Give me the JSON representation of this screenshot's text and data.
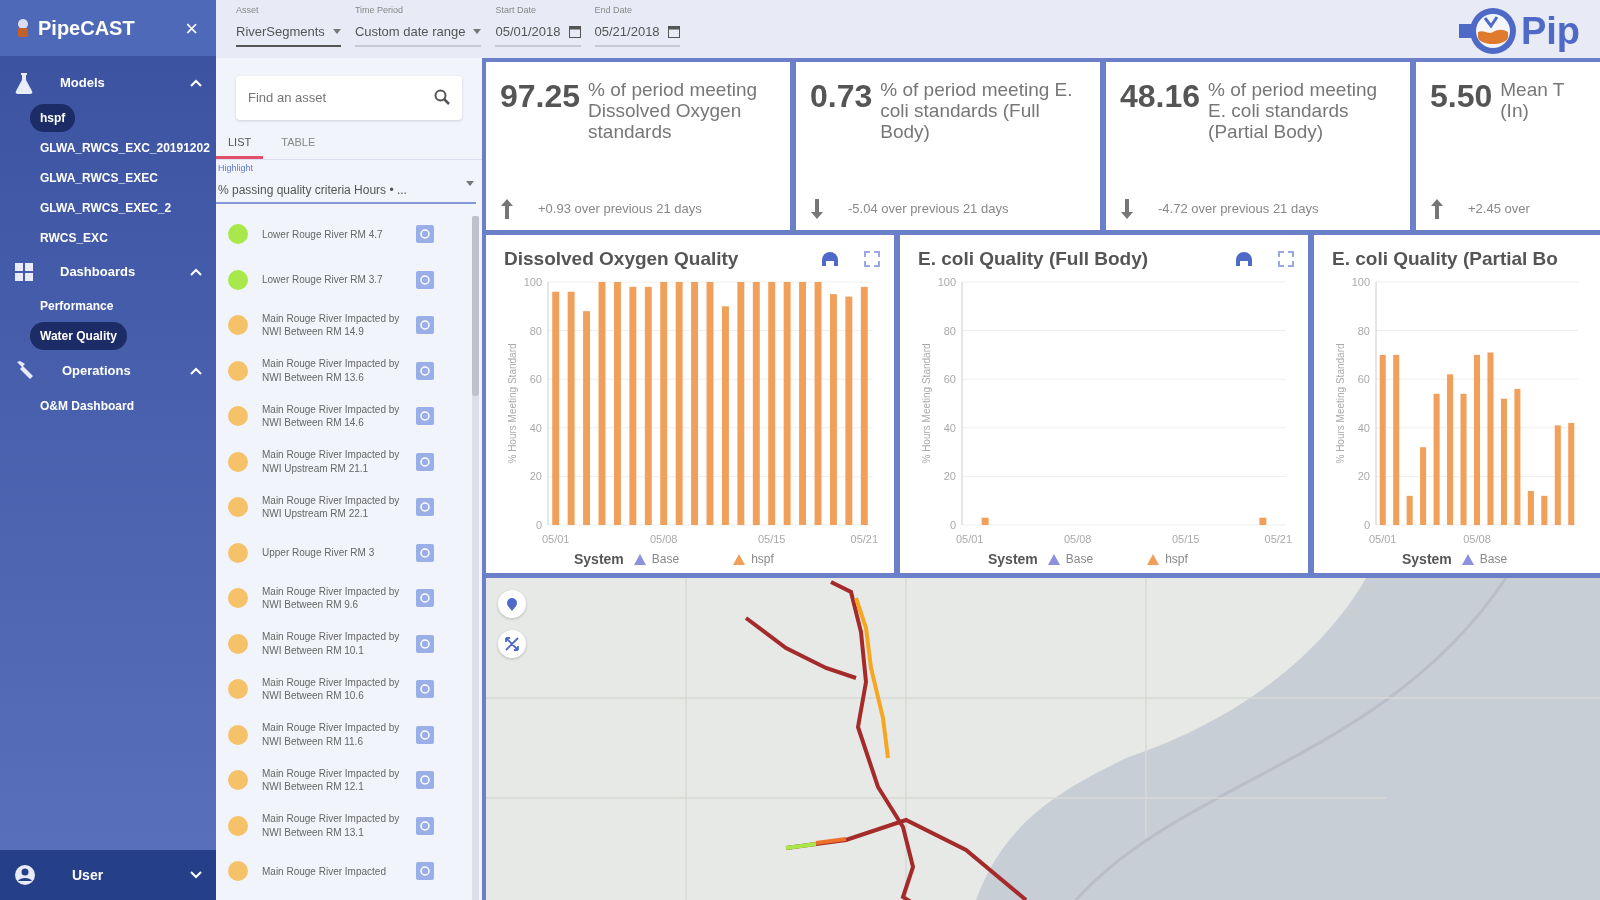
{
  "sidebar": {
    "title": "PipeCAST",
    "close": "×",
    "groups": [
      {
        "label": "Models",
        "expanded": true,
        "items": [
          {
            "label": "hspf",
            "selected": true
          },
          {
            "label": "GLWA_RWCS_EXC_20191202",
            "selected": false
          },
          {
            "label": "GLWA_RWCS_EXEC",
            "selected": false
          },
          {
            "label": "GLWA_RWCS_EXEC_2",
            "selected": false
          },
          {
            "label": "RWCS_EXC",
            "selected": false
          }
        ]
      },
      {
        "label": "Dashboards",
        "expanded": true,
        "items": [
          {
            "label": "Performance",
            "selected": false
          },
          {
            "label": "Water Quality",
            "selected": true
          }
        ]
      },
      {
        "label": "Operations",
        "expanded": true,
        "items": [
          {
            "label": "O&M Dashboard",
            "selected": false
          }
        ]
      }
    ],
    "user": {
      "label": "User",
      "expanded": false
    }
  },
  "toolbar": {
    "fields": [
      {
        "label": "Asset",
        "value": "RiverSegments",
        "kind": "select"
      },
      {
        "label": "Time Period",
        "value": "Custom date range",
        "kind": "select"
      },
      {
        "label": "Start Date",
        "value": "05/01/2018",
        "kind": "date"
      },
      {
        "label": "End Date",
        "value": "05/21/2018",
        "kind": "date"
      }
    ],
    "logo_text": "Pip"
  },
  "asset_panel": {
    "search": {
      "placeholder": "Find an asset"
    },
    "tabs": [
      {
        "label": "LIST",
        "selected": true
      },
      {
        "label": "TABLE",
        "selected": false
      }
    ],
    "highlight": {
      "label": "Highlight",
      "value": "% passing quality criteria Hours • ..."
    },
    "assets": [
      {
        "name": "Lower Rouge River RM 4.7",
        "color": "#a8e84a"
      },
      {
        "name": "Lower Rouge River RM 3.7",
        "color": "#a8e84a"
      },
      {
        "name": "Main Rouge River Impacted by NWI Between RM 14.9",
        "color": "#f5c26a"
      },
      {
        "name": "Main Rouge River Impacted by NWI Between RM 13.6",
        "color": "#f5c26a"
      },
      {
        "name": "Main Rouge River Impacted by NWI Between RM 14.6",
        "color": "#f5c26a"
      },
      {
        "name": "Main Rouge River Impacted by NWI Upstream RM 21.1",
        "color": "#f5c26a"
      },
      {
        "name": "Main Rouge River Impacted by NWI Upstream RM 22.1",
        "color": "#f5c26a"
      },
      {
        "name": "Upper Rouge River RM 3",
        "color": "#f5c26a"
      },
      {
        "name": "Main Rouge River Impacted by NWI Between RM 9.6",
        "color": "#f5c26a"
      },
      {
        "name": "Main Rouge River Impacted by NWI Between RM 10.1",
        "color": "#f5c26a"
      },
      {
        "name": "Main Rouge River Impacted by NWI Between RM 10.6",
        "color": "#f5c26a"
      },
      {
        "name": "Main Rouge River Impacted by NWI Between RM 11.6",
        "color": "#f5c26a"
      },
      {
        "name": "Main Rouge River Impacted by NWI Between RM 12.1",
        "color": "#f5c26a"
      },
      {
        "name": "Main Rouge River Impacted by NWI Between RM 13.1",
        "color": "#f5c26a"
      },
      {
        "name": "Main Rouge River Impacted",
        "color": "#f5c26a"
      }
    ]
  },
  "kpis": [
    {
      "value": "97.25",
      "label": "% of period meeting Dissolved Oxygen standards",
      "kind": "up",
      "delta": "+0.93 over previous 21 days"
    },
    {
      "value": "0.73",
      "label": "% of period meeting E. coli standards (Full Body)",
      "kind": "down",
      "delta": "-5.04 over previous 21 days"
    },
    {
      "value": "48.16",
      "label": "% of period meeting E. coli standards (Partial Body)",
      "kind": "down",
      "delta": "-4.72 over previous 21 days"
    },
    {
      "value": "5.50",
      "label": "Mean T (In)",
      "kind": "up",
      "delta": "+2.45 over"
    }
  ],
  "charts": [
    {
      "title": "Dissolved Oxygen Quality",
      "legend_title": "System",
      "chart_data": {
        "type": "bar",
        "ylabel": "% Hours Meeting Standard",
        "grid": true,
        "categories": [
          "05/01",
          null,
          null,
          null,
          null,
          null,
          null,
          "05/08",
          null,
          null,
          null,
          null,
          null,
          null,
          "05/15",
          null,
          null,
          null,
          null,
          null,
          "05/21"
        ],
        "series": [
          {
            "name": "Base",
            "color": "#8d90dc",
            "values": [
              null,
              null,
              null,
              null,
              null,
              null,
              null,
              null,
              null,
              null,
              null,
              null,
              null,
              null,
              null,
              null,
              null,
              null,
              null,
              null,
              null
            ]
          },
          {
            "name": "hspf",
            "color": "#f0a05a",
            "values": [
              96,
              96,
              88,
              100,
              100,
              98,
              98,
              100,
              100,
              100,
              100,
              90,
              100,
              100,
              100,
              100,
              100,
              100,
              95,
              94,
              98
            ]
          }
        ],
        "ylim": [
          0,
          100
        ],
        "yticks": [
          0,
          20,
          40,
          60,
          80,
          100
        ]
      }
    },
    {
      "title": "E. coli Quality (Full Body)",
      "legend_title": "System",
      "chart_data": {
        "type": "bar",
        "ylabel": "% Hours Meeting Standard",
        "grid": true,
        "categories": [
          "05/01",
          null,
          null,
          null,
          null,
          null,
          null,
          "05/08",
          null,
          null,
          null,
          null,
          null,
          null,
          "05/15",
          null,
          null,
          null,
          null,
          null,
          "05/21"
        ],
        "series": [
          {
            "name": "Base",
            "color": "#8d90dc",
            "values": [
              null,
              null,
              null,
              null,
              null,
              null,
              null,
              null,
              null,
              null,
              null,
              null,
              null,
              null,
              null,
              null,
              null,
              null,
              null,
              null,
              null
            ]
          },
          {
            "name": "hspf",
            "color": "#f0a05a",
            "values": [
              0,
              3,
              0,
              0,
              0,
              0,
              0,
              0,
              0,
              0,
              0,
              0,
              0,
              0,
              0,
              0,
              0,
              0,
              0,
              3,
              0
            ]
          }
        ],
        "ylim": [
          0,
          100
        ],
        "yticks": [
          0,
          20,
          40,
          60,
          80,
          100
        ]
      }
    },
    {
      "title": "E. coli Quality (Partial Bo",
      "legend_title": "System",
      "chart_data": {
        "type": "bar",
        "ylabel": "% Hours Meeting Standard",
        "grid": true,
        "categories": [
          "05/01",
          null,
          null,
          null,
          null,
          null,
          null,
          "05/08",
          null,
          null,
          null,
          null,
          null,
          null,
          null
        ],
        "series": [
          {
            "name": "Base",
            "color": "#8d90dc",
            "values": [
              null,
              null,
              null,
              null,
              null,
              null,
              null,
              null,
              null,
              null,
              null,
              null,
              null,
              null,
              null
            ]
          },
          {
            "color": "#f0a05a",
            "values": [
              70,
              70,
              12,
              32,
              54,
              62,
              54,
              70,
              71,
              52,
              56,
              14,
              12,
              41,
              42
            ]
          }
        ],
        "ylim": [
          0,
          100
        ],
        "yticks": [
          0,
          20,
          40,
          60,
          80,
          100
        ]
      }
    }
  ]
}
